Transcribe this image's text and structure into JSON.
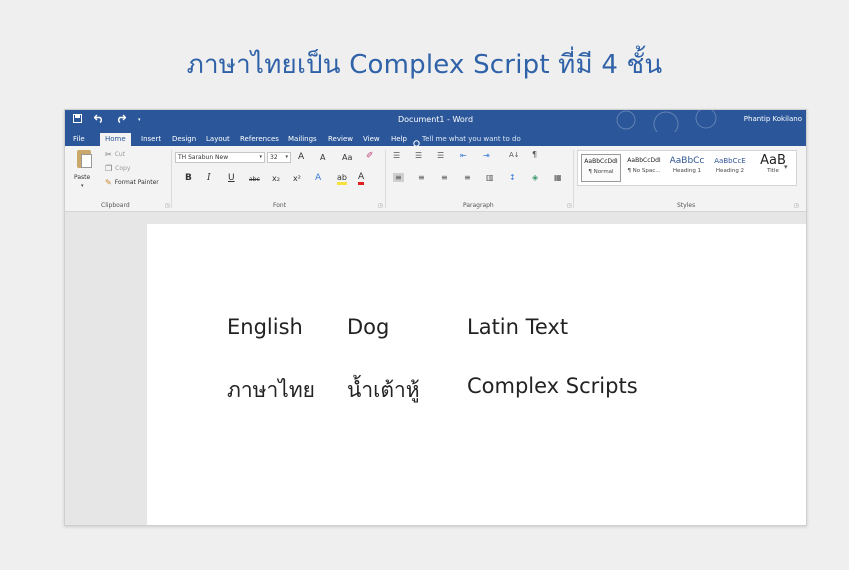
{
  "slide": {
    "title": "ภาษาไทยเป็น Complex Script ที่มี 4 ชั้น"
  },
  "window": {
    "title": "Document1  -  Word",
    "user": "Phantip Kokilano",
    "qat": {
      "save_icon": "save-icon",
      "undo_icon": "undo-icon",
      "redo_icon": "redo-icon",
      "more": "▾"
    }
  },
  "tabs": [
    "File",
    "Home",
    "Insert",
    "Design",
    "Layout",
    "References",
    "Mailings",
    "Review",
    "View",
    "Help"
  ],
  "tellme": "Tell me what you want to do",
  "clipboard": {
    "paste": "Paste",
    "paste_arrow": "▾",
    "cut": "Cut",
    "copy": "Copy",
    "format_painter": "Format Painter",
    "label": "Clipboard"
  },
  "font": {
    "family": "TH Sarabun New",
    "size": "32",
    "label": "Font",
    "grow": "A",
    "shrink": "A",
    "case": "Aa",
    "bold": "B",
    "italic": "I",
    "underline": "U",
    "strike": "abc",
    "sub": "x₂",
    "sup": "x²",
    "effects": "A",
    "highlight": "ab",
    "color": "A"
  },
  "paragraph": {
    "label": "Paragraph",
    "sort": "A↓",
    "pilcrow": "¶"
  },
  "styles": {
    "label": "Styles",
    "items": [
      {
        "sample": "AaBbCcDdI",
        "name": "¶ Normal"
      },
      {
        "sample": "AaBbCcDdI",
        "name": "¶ No Spac..."
      },
      {
        "sample": "AaBbCc",
        "name": "Heading 1"
      },
      {
        "sample": "AaBbCcE",
        "name": "Heading 2"
      },
      {
        "sample": "AaB",
        "name": "Title"
      }
    ]
  },
  "document": {
    "row1": [
      "English",
      "Dog",
      "Latin Text"
    ],
    "row2": [
      "ภาษาไทย",
      "น้ำเต้าหู้",
      "Complex Scripts"
    ]
  },
  "colors": {
    "word_blue": "#2b579a",
    "title_blue": "#2f62a8",
    "highlight_yellow": "#f7e23b",
    "font_red": "#e02020"
  }
}
